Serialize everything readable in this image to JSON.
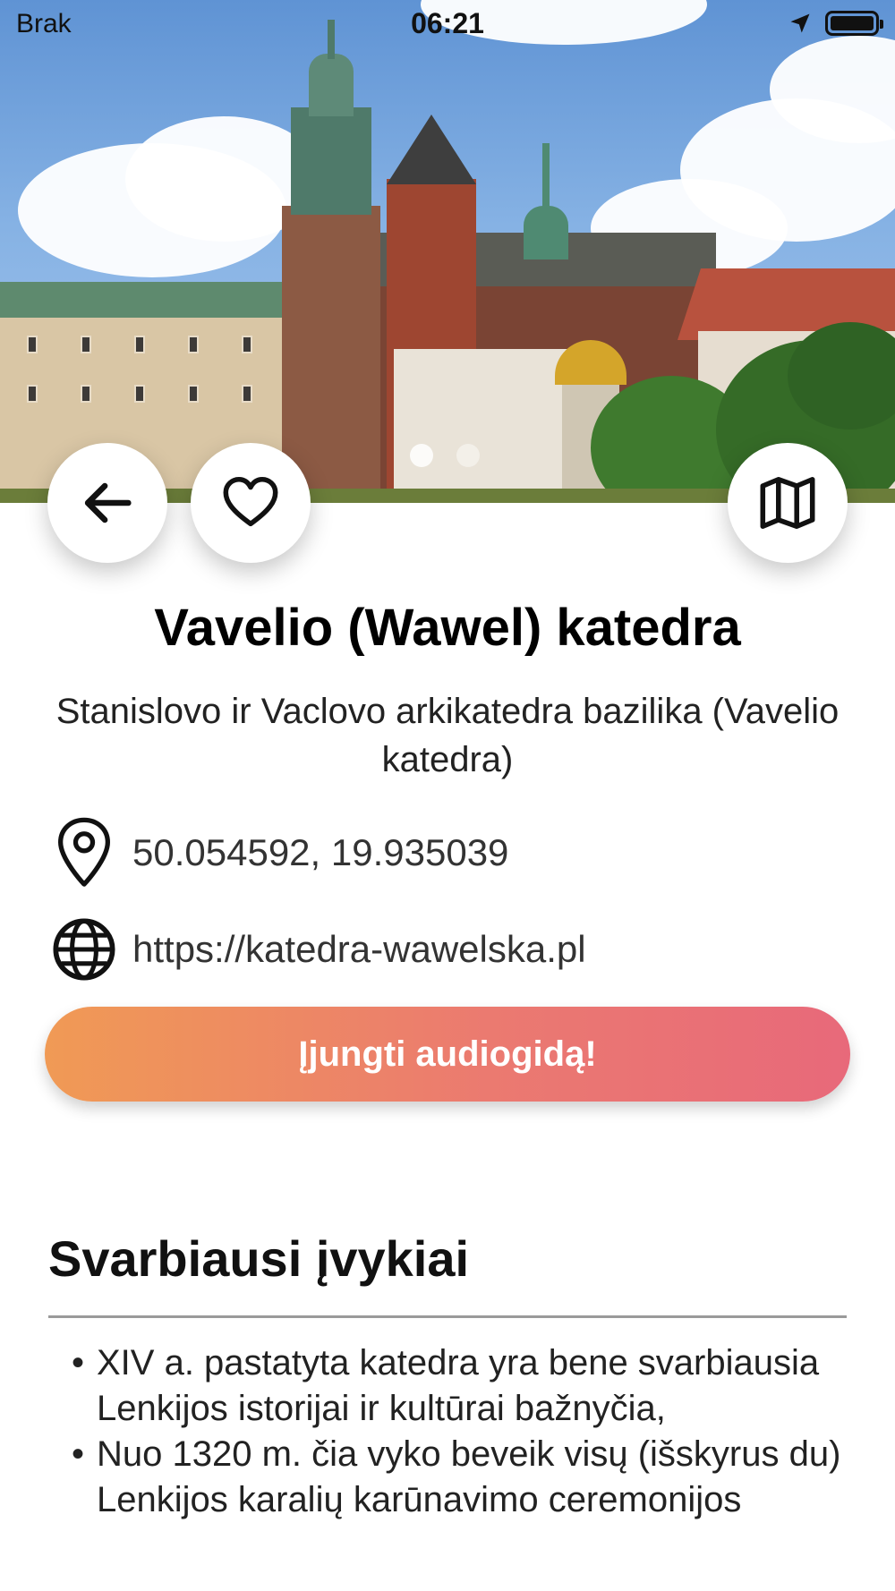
{
  "status_bar": {
    "carrier": "Brak",
    "time": "06:21",
    "location_icon": "location-arrow-icon",
    "battery_icon": "battery-icon"
  },
  "hero": {
    "image": "cathedral-photo",
    "carousel_pages": 2,
    "carousel_active": 1
  },
  "actions": {
    "back_icon": "arrow-left-icon",
    "favorite_icon": "heart-icon",
    "map_icon": "map-icon"
  },
  "place": {
    "title": "Vavelio (Wawel) katedra",
    "subtitle": "Stanislovo ir Vaclovo arkikatedra bazilika (Vavelio katedra)",
    "coordinates": "50.054592, 19.935039",
    "website": "https://katedra-wawelska.pl"
  },
  "audio_button": {
    "label": "Įjungti audiogidą!"
  },
  "highlights": {
    "title": "Svarbiausi įvykiai",
    "items": [
      "XIV a. pastatyta katedra yra bene svarbiausia Lenkijos istorijai ir kultūrai bažnyčia,",
      "Nuo 1320 m. čia vyko beveik visų (išskyrus du) Lenkijos karalių karūnavimo ceremonijos"
    ]
  },
  "colors": {
    "cta_start": "#f09a55",
    "cta_end": "#e8697a"
  }
}
